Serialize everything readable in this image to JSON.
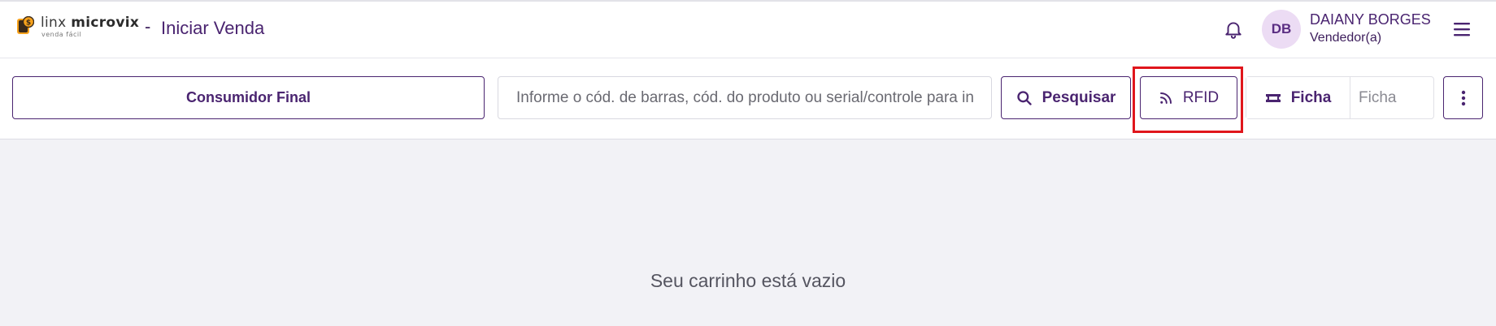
{
  "brand": {
    "name_light": "linx",
    "name_bold": "microvix",
    "tagline": "venda fácil",
    "mark_color": "#f7a21b"
  },
  "header": {
    "separator": "-",
    "title": "Iniciar Venda",
    "notification_icon": "bell-icon",
    "menu_icon": "hamburger-menu-icon"
  },
  "user": {
    "initials": "DB",
    "name": "DAIANY BORGES",
    "role": "Vendedor(a)"
  },
  "toolbar": {
    "customer_label": "Consumidor Final",
    "search_placeholder": "Informe o cód. de barras, cód. do produto ou serial/controle para in",
    "search_button_label": "Pesquisar",
    "search_button_icon": "search-icon",
    "rfid_label": "RFID",
    "rfid_icon": "rss-feed-icon",
    "ficha_label": "Ficha",
    "ficha_icon": "ticket-icon",
    "ficha_placeholder": "Ficha",
    "more_icon": "more-vertical-icon"
  },
  "cart": {
    "empty_message": "Seu carrinho está vazio"
  },
  "colors": {
    "accent": "#4a2470",
    "highlight": "#e0161c",
    "avatar_bg": "#ecdcf4",
    "background": "#f2f2f6"
  }
}
